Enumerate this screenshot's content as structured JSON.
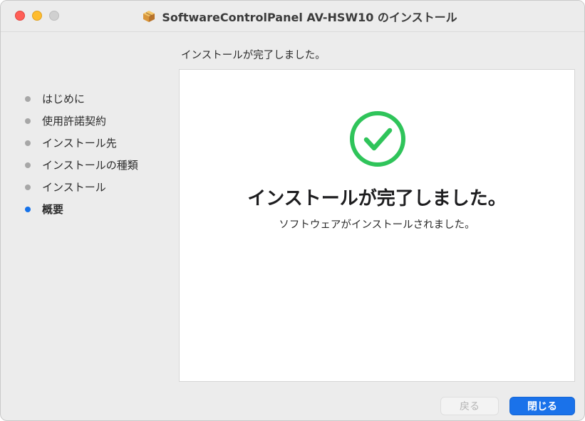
{
  "window": {
    "title": "SoftwareControlPanel AV-HSW10 のインストール",
    "icon": "package-icon"
  },
  "sidebar": {
    "steps": [
      {
        "label": "はじめに",
        "state": "done"
      },
      {
        "label": "使用許諾契約",
        "state": "done"
      },
      {
        "label": "インストール先",
        "state": "done"
      },
      {
        "label": "インストールの種類",
        "state": "done"
      },
      {
        "label": "インストール",
        "state": "done"
      },
      {
        "label": "概要",
        "state": "current"
      }
    ]
  },
  "main": {
    "heading": "インストールが完了しました。",
    "status_icon": "checkmark-circle-icon",
    "title": "インストールが完了しました。",
    "subtitle": "ソフトウェアがインストールされました。"
  },
  "footer": {
    "back_label": "戻る",
    "close_label": "閉じる"
  },
  "colors": {
    "accent": "#1a72ea",
    "success": "#2fc45a",
    "inactive_dot": "#a7a7a7"
  }
}
